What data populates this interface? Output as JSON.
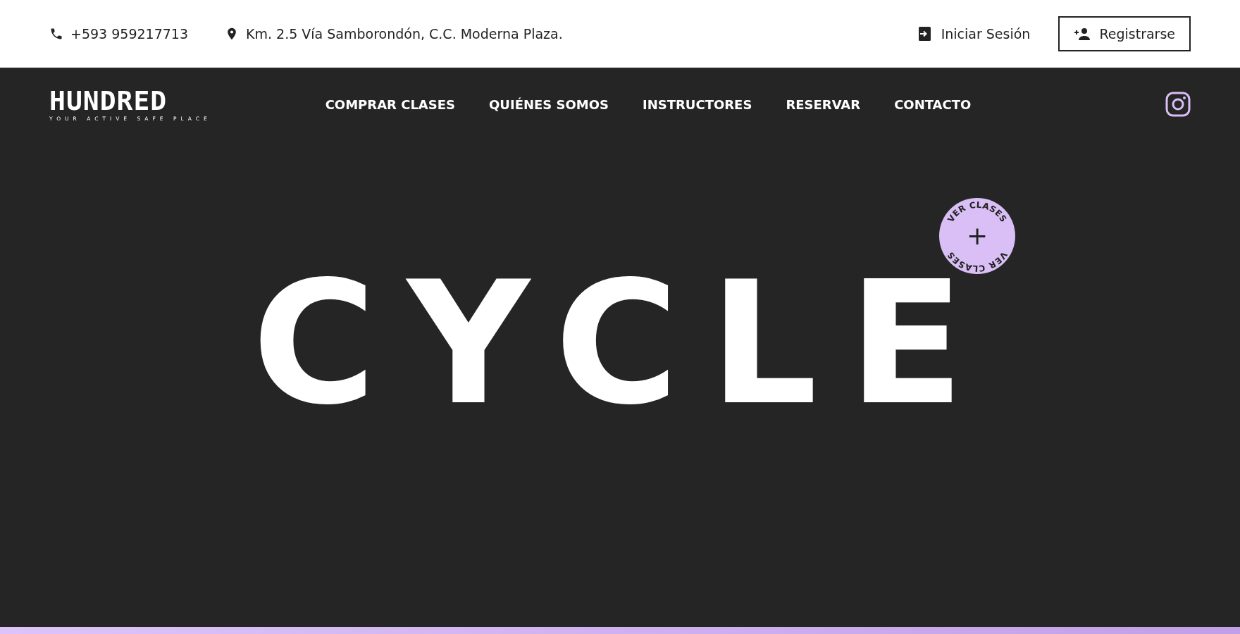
{
  "top_bar": {
    "phone": "+593 959217713",
    "address": "Km. 2.5 Vía Samborondón, C.C. Moderna Plaza.",
    "login": "Iniciar Sesión",
    "register": "Registrarse"
  },
  "nav": {
    "logo": "HUNDRED",
    "tagline": "YOUR ACTIVE SAFE PLACE",
    "links": [
      {
        "label": "COMPRAR CLASES"
      },
      {
        "label": "QUIÉNES SOMOS"
      },
      {
        "label": "INSTRUCTORES"
      },
      {
        "label": "RESERVAR"
      },
      {
        "label": "CONTACTO"
      }
    ]
  },
  "hero": {
    "title": "CYCLE",
    "badge": {
      "top_text": "VER CLASES",
      "bottom_text": "VER CLASES",
      "symbol": "+"
    }
  }
}
